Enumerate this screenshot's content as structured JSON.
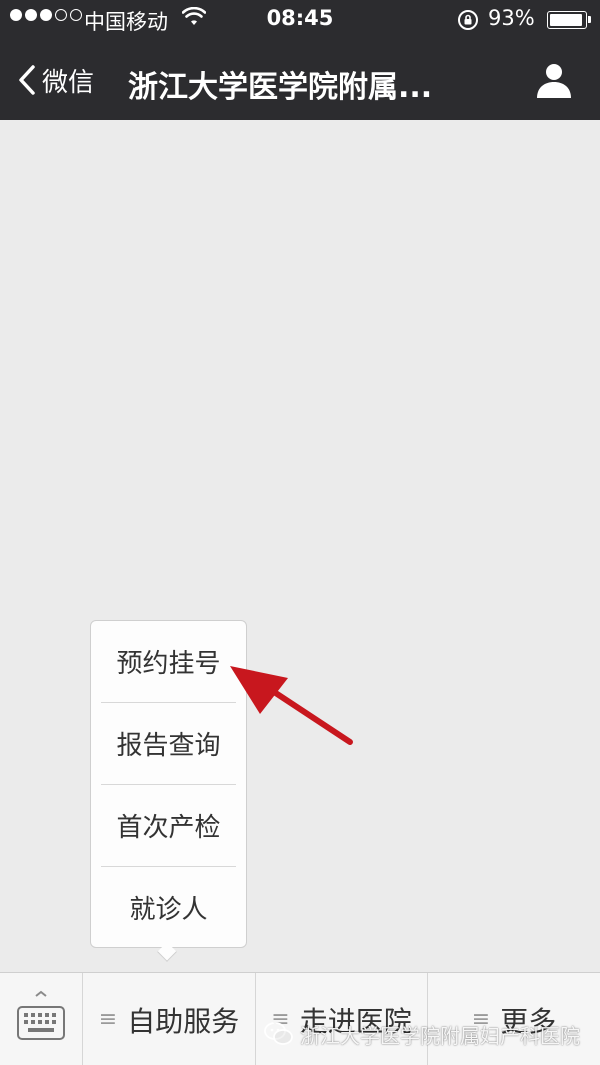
{
  "status_bar": {
    "carrier": "中国移动",
    "time": "08:45",
    "battery_percent": "93%",
    "battery_level": 0.93,
    "signal_bars_filled": 3,
    "signal_bars_total": 5
  },
  "nav": {
    "back_label": "微信",
    "title": "浙江大学医学院附属..."
  },
  "popup_menu": {
    "items": [
      "预约挂号",
      "报告查询",
      "首次产检",
      "就诊人"
    ]
  },
  "bottom_menu": {
    "items": [
      {
        "label": "自助服务",
        "glyph": "≡"
      },
      {
        "label": "走进医院",
        "glyph": "≡"
      },
      {
        "label": "更多",
        "glyph": "≡"
      }
    ]
  },
  "watermark": {
    "text": "浙江大学医学院附属妇产科医院"
  },
  "colors": {
    "top_bar": "#2c2c2f",
    "background": "#ebebeb",
    "annotation_arrow": "#c8171e"
  },
  "icons": {
    "back": "chevron-left-icon",
    "profile": "person-icon",
    "keyboard": "keyboard-icon",
    "wifi": "wifi-icon",
    "lock": "rotation-lock-icon",
    "watermark_logo": "wechat-logo-icon"
  }
}
